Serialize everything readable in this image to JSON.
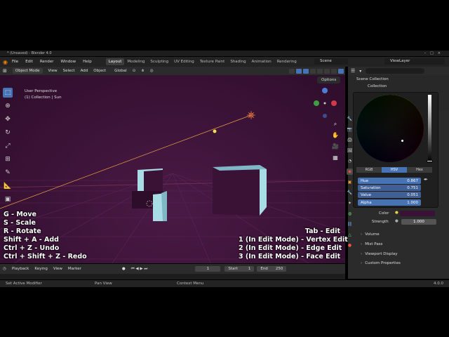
{
  "app": {
    "window_title": "* (Unsaved) - Blender 4.0",
    "version": "4.0.0"
  },
  "menu": [
    "File",
    "Edit",
    "Render",
    "Window",
    "Help"
  ],
  "workspaces": [
    "Layout",
    "Modeling",
    "Sculpting",
    "UV Editing",
    "Texture Paint",
    "Shading",
    "Animation",
    "Rendering"
  ],
  "active_workspace": "Layout",
  "scene_name": "Scene",
  "view_layer": "ViewLayer",
  "viewport_header": {
    "mode": "Object Mode",
    "menus": [
      "View",
      "Select",
      "Add",
      "Object"
    ],
    "transform": "Global"
  },
  "viewport": {
    "perspective": "User Perspective",
    "collection_info": "(1) Collection | Sun",
    "options": "Options"
  },
  "shortcuts_left": [
    "G - Move",
    "S - Scale",
    "R - Rotate",
    "Shift + A - Add",
    "Ctrl + Z - Undo",
    "Ctrl + Shift + Z - Redo"
  ],
  "shortcuts_right": [
    "Tab - Edit",
    "1 (In Edit Mode) - Vertex Edit",
    "2 (In Edit Mode) - Edge Edit",
    "3 (In Edit Mode) - Face Edit"
  ],
  "timeline": {
    "menus": [
      "Playback",
      "Keying",
      "View",
      "Marker"
    ],
    "current_frame": "1",
    "start_label": "Start",
    "start": "1",
    "end_label": "End",
    "end": "250"
  },
  "statusbar": {
    "left": "Set Active Modifier",
    "middle": "Pan View",
    "right": "Context Menu"
  },
  "outliner": {
    "scene_collection": "Scene Collection",
    "collection": "Collection"
  },
  "color_picker": {
    "modes": [
      "RGB",
      "HSV",
      "Hex"
    ],
    "active_mode": "HSV",
    "fields": [
      {
        "label": "Hue",
        "value": "0.867"
      },
      {
        "label": "Saturation",
        "value": "0.751"
      },
      {
        "label": "Value",
        "value": "0.051"
      },
      {
        "label": "Alpha",
        "value": "1.000"
      }
    ]
  },
  "world_props": {
    "color_label": "Color",
    "strength_label": "Strength",
    "strength": "1.000",
    "sections": [
      "Volume",
      "Mist Pass",
      "Viewport Display",
      "Custom Properties"
    ]
  },
  "colors": {
    "accent": "#4772b3",
    "background_world": "#3a1236",
    "object": "#a9dde6"
  }
}
